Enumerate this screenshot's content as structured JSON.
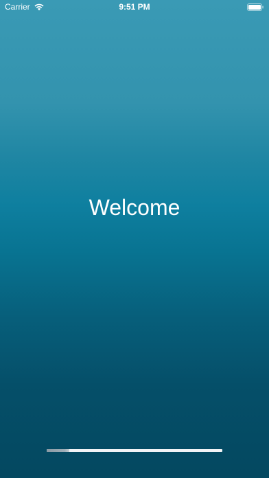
{
  "status_bar": {
    "carrier": "Carrier",
    "time": "9:51 PM",
    "wifi_icon": "wifi-icon",
    "battery_icon": "battery-icon"
  },
  "main": {
    "welcome_text": "Welcome"
  },
  "loading": {
    "progress": 0.13
  },
  "colors": {
    "gradient_top": "#3a9ab5",
    "gradient_mid": "#0e7f9f",
    "gradient_bottom": "#044860",
    "text": "#ffffff",
    "progress_track": "#f2f4f6",
    "progress_fill": "#9aaab4"
  }
}
